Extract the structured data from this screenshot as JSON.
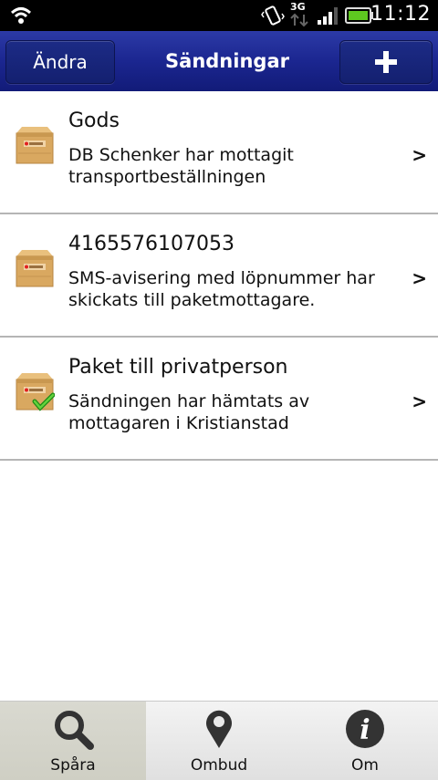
{
  "status_bar": {
    "network": "3G",
    "time": "11:12",
    "icons": [
      "wifi-icon",
      "vibrate-icon",
      "3g-icon",
      "signal-icon",
      "battery-icon"
    ]
  },
  "header": {
    "edit_label": "Ändra",
    "title": "Sändningar",
    "add_label": "+"
  },
  "shipments": [
    {
      "title": "Gods",
      "description": "DB Schenker har mottagit transportbeställningen",
      "chevron": ">",
      "delivered": false
    },
    {
      "title": "4165576107053",
      "description": "SMS-avisering med löpnummer har skickats till paketmottagare.",
      "chevron": ">",
      "delivered": false
    },
    {
      "title": "Paket till privatperson",
      "description": "Sändningen har hämtats av mottagaren i Kristianstad",
      "chevron": ">",
      "delivered": true
    }
  ],
  "tabs": [
    {
      "label": "Spåra",
      "icon": "search-icon",
      "active": true
    },
    {
      "label": "Ombud",
      "icon": "location-pin-icon",
      "active": false
    },
    {
      "label": "Om",
      "icon": "info-icon",
      "active": false
    }
  ],
  "colors": {
    "header": "#1b2690",
    "active_tab": "#d4d4ca",
    "divider": "#b5b5b5"
  }
}
